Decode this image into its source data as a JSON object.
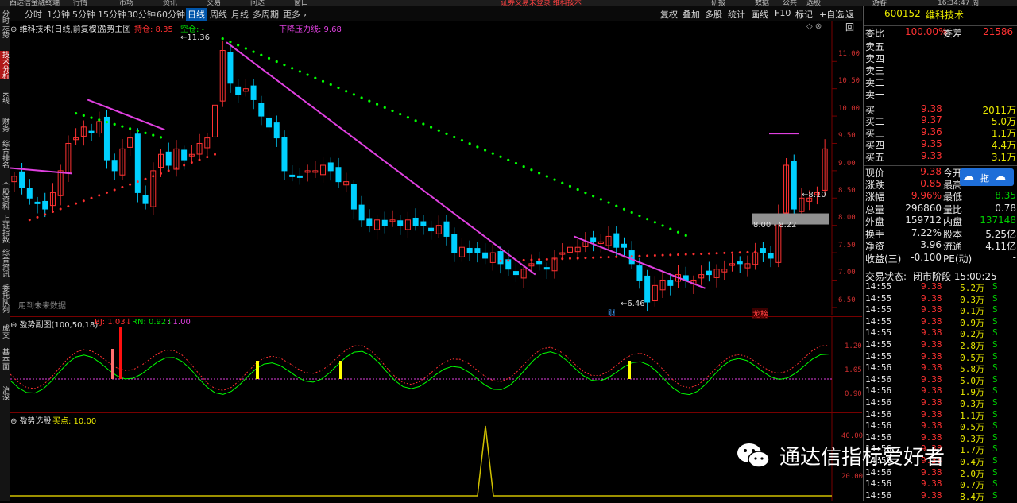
{
  "top_menu": [
    "西达信金融终端",
    "行情",
    "市场",
    "资讯",
    "交易",
    "问达",
    "窗口",
    "研报",
    "数据",
    "公共",
    "选股",
    "游客"
  ],
  "top_center": "证券交易未登录 维科技术",
  "top_time": "16:34:47 周",
  "left_tabs": [
    "分时走势",
    "技术分析",
    "K线",
    "财务",
    "综合排名",
    "个股资料",
    "上证指数",
    "综合资讯",
    "委托队列",
    "成交",
    "基本面",
    "沪深"
  ],
  "period_tabs": [
    {
      "label": "分时",
      "active": false
    },
    {
      "label": "1分钟",
      "active": false
    },
    {
      "label": "5分钟",
      "active": false
    },
    {
      "label": "15分钟",
      "active": false
    },
    {
      "label": "30分钟",
      "active": false
    },
    {
      "label": "60分钟",
      "active": false
    },
    {
      "label": "日线",
      "active": true
    },
    {
      "label": "周线",
      "active": false
    },
    {
      "label": "月线",
      "active": false
    },
    {
      "label": "多周期",
      "active": false
    },
    {
      "label": "更多 ›",
      "active": false
    }
  ],
  "toolbar_buttons": [
    "复权",
    "叠加",
    "多股",
    "统计",
    "画线",
    "F10",
    "标记",
    "+自选",
    "返回"
  ],
  "main_chart": {
    "title": "维科技术(日线,前复权)",
    "indicator_name": "盈势主图",
    "holding_label": "持仓: 8.35",
    "empty_label": "空仓: -",
    "resistance_label": "下降压力线: 9.68",
    "future_note": "用到未来数据",
    "high_label": "11.36",
    "low_label": "6.46",
    "range_label": "8.00 - 8.22",
    "last_label": "8.10",
    "lhb_badge": "龙榜",
    "cai_badge": "财",
    "y_ticks": [
      "11.00",
      "10.50",
      "10.00",
      "9.50",
      "9.00",
      "8.50",
      "8.00",
      "7.50",
      "7.00",
      "6.50"
    ]
  },
  "sub_chart1": {
    "title": "盈势副图(100,50,18)",
    "bj": "BJ: 1.03↓",
    "rn": "RN: 0.92↓",
    "third": ": 1.00",
    "y_ticks": [
      "1.20",
      "1.05",
      "0.90"
    ]
  },
  "sub_chart2": {
    "title": "盈势选股",
    "buy_label": "买点: 10.00",
    "y_ticks": [
      "40.00",
      "20.00"
    ]
  },
  "right_panel": {
    "stock_code": "600152",
    "stock_name": "维科技术",
    "weibi_label": "委比",
    "weibi_value": "100.00%",
    "weicha_label": "委差",
    "weicha_value": "21586",
    "sell_levels": [
      {
        "label": "卖五",
        "price": "",
        "vol": ""
      },
      {
        "label": "卖四",
        "price": "",
        "vol": ""
      },
      {
        "label": "卖三",
        "price": "",
        "vol": ""
      },
      {
        "label": "卖二",
        "price": "",
        "vol": ""
      },
      {
        "label": "卖一",
        "price": "",
        "vol": ""
      }
    ],
    "buy_levels": [
      {
        "label": "买一",
        "price": "9.38",
        "vol": "2011万"
      },
      {
        "label": "买二",
        "price": "9.37",
        "vol": "5.0万"
      },
      {
        "label": "买三",
        "price": "9.36",
        "vol": "1.1万"
      },
      {
        "label": "买四",
        "price": "9.35",
        "vol": "4.4万"
      },
      {
        "label": "买五",
        "price": "9.33",
        "vol": "3.1万"
      }
    ],
    "quote_rows": [
      {
        "l1": "现价",
        "v1": "9.38",
        "l2": "今开",
        "v2": ""
      },
      {
        "l1": "涨跌",
        "v1": "0.85",
        "l2": "最高",
        "v2": ""
      },
      {
        "l1": "涨幅",
        "v1": "9.96%",
        "l2": "最低",
        "v2": "8.35"
      },
      {
        "l1": "总量",
        "v1": "296860",
        "l2": "量比",
        "v2": "0.78"
      },
      {
        "l1": "外盘",
        "v1": "159712",
        "l2": "内盘",
        "v2": "137148"
      },
      {
        "l1": "换手",
        "v1": "7.22%",
        "l2": "股本",
        "v2": "5.25亿"
      },
      {
        "l1": "净资",
        "v1": "3.96",
        "l2": "流通",
        "v2": "4.11亿"
      },
      {
        "l1": "收益(三)",
        "v1": "-0.100",
        "l2": "PE(动)",
        "v2": "-"
      }
    ],
    "trade_status_label": "交易状态:",
    "trade_status_value": "闭市阶段 15:00:25",
    "ticks": [
      {
        "t": "14:55",
        "p": "9.38",
        "v": "5.2万",
        "s": "S"
      },
      {
        "t": "14:55",
        "p": "9.38",
        "v": "0.3万",
        "s": "S"
      },
      {
        "t": "14:55",
        "p": "9.38",
        "v": "0.1万",
        "s": "S"
      },
      {
        "t": "14:55",
        "p": "9.38",
        "v": "0.9万",
        "s": "S"
      },
      {
        "t": "14:55",
        "p": "9.38",
        "v": "0.2万",
        "s": "S"
      },
      {
        "t": "14:55",
        "p": "9.38",
        "v": "2.8万",
        "s": "S"
      },
      {
        "t": "14:55",
        "p": "9.38",
        "v": "0.5万",
        "s": "S"
      },
      {
        "t": "14:56",
        "p": "9.38",
        "v": "5.8万",
        "s": "S"
      },
      {
        "t": "14:56",
        "p": "9.38",
        "v": "5.0万",
        "s": "S"
      },
      {
        "t": "14:56",
        "p": "9.38",
        "v": "1.9万",
        "s": "S"
      },
      {
        "t": "14:56",
        "p": "9.38",
        "v": "0.3万",
        "s": "S"
      },
      {
        "t": "14:56",
        "p": "9.38",
        "v": "1.1万",
        "s": "S"
      },
      {
        "t": "14:56",
        "p": "9.38",
        "v": "0.5万",
        "s": "S"
      },
      {
        "t": "14:56",
        "p": "9.38",
        "v": "0.3万",
        "s": "S"
      },
      {
        "t": "14:56",
        "p": "9.38",
        "v": "1.7万",
        "s": "S"
      },
      {
        "t": "14:56",
        "p": "9.38",
        "v": "0.4万",
        "s": "S"
      },
      {
        "t": "14:56",
        "p": "9.38",
        "v": "2.0万",
        "s": "S"
      },
      {
        "t": "14:56",
        "p": "9.38",
        "v": "0.7万",
        "s": "S"
      },
      {
        "t": "14:56",
        "p": "9.38",
        "v": "8.4万",
        "s": "S"
      }
    ]
  },
  "watermark_text": "通达信指标爱好者",
  "float_button_label": "拖",
  "colors": {
    "up": "#ff3232",
    "down": "#00d0ff",
    "ma_green": "#00ff00",
    "resistance": "#e040e0",
    "axis": "#d03030"
  }
}
